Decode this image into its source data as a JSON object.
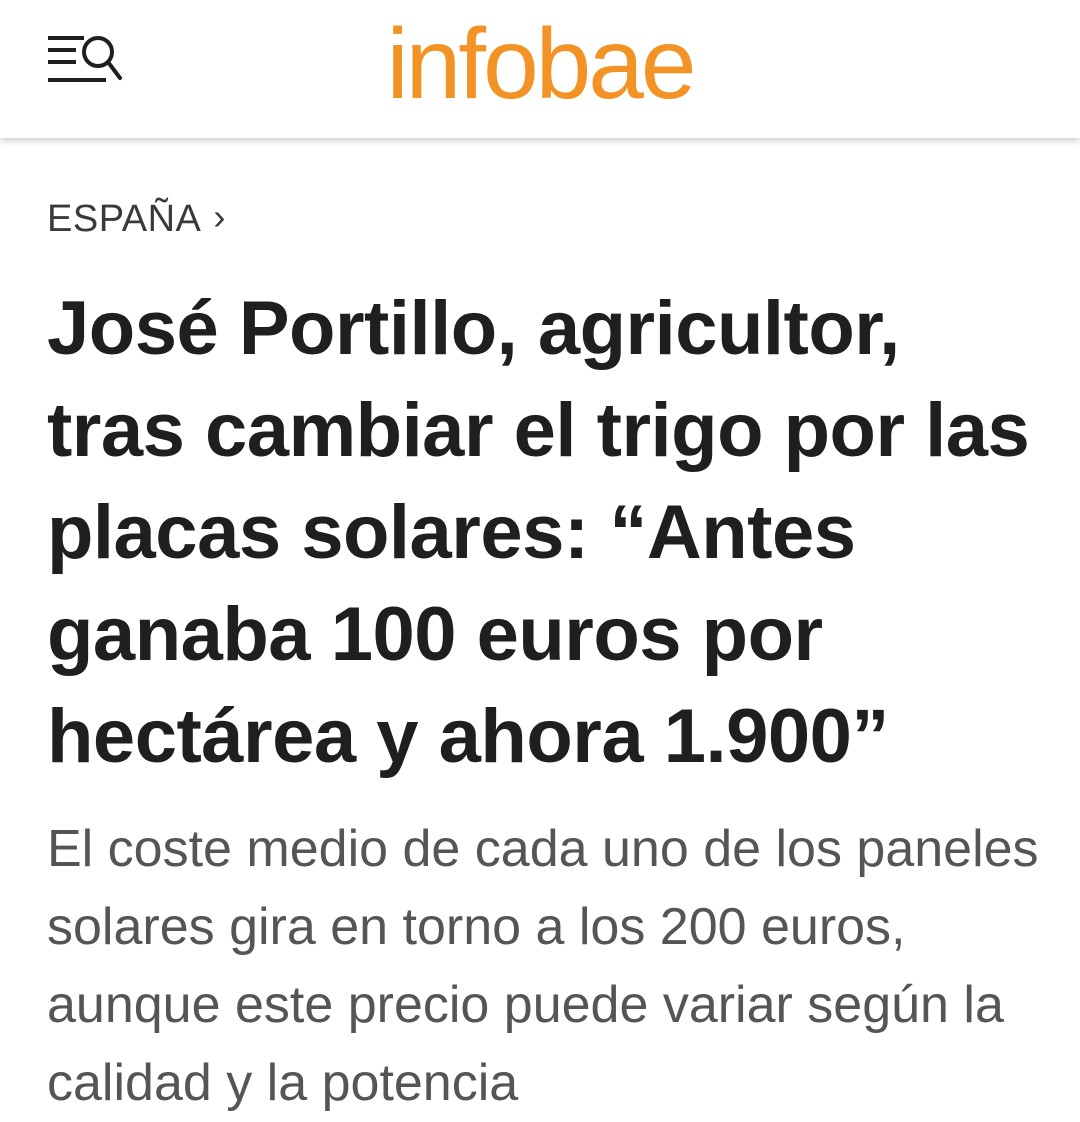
{
  "header": {
    "logo_text": "infobae",
    "menu_icon": "menu-search-icon",
    "brand_color": "#f39325"
  },
  "article": {
    "section": "ESPAÑA",
    "section_chevron": "›",
    "headline": "José Portillo, agricultor, tras cambiar el trigo por las placas solares: “Antes ganaba 100 euros por hectárea y ahora 1.900”",
    "subheadline": "El coste medio de cada uno de los paneles solares gira en torno a los 200 euros, aunque este precio puede variar según la calidad y la potencia"
  }
}
